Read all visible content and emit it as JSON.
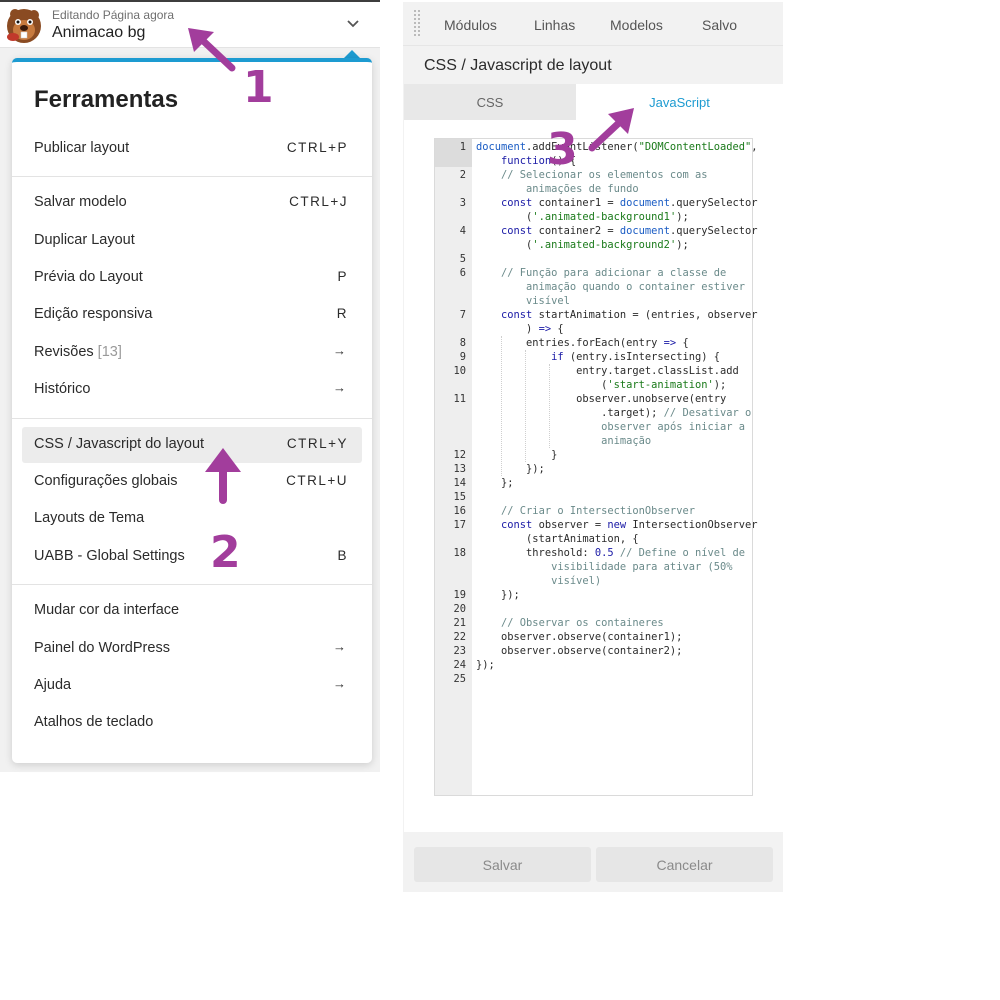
{
  "header": {
    "editing_label": "Editando Página agora",
    "page_name": "Animacao bg"
  },
  "menu": {
    "title": "Ferramentas",
    "items": [
      {
        "label": "Publicar layout",
        "shortcut": "CTRL+P"
      },
      {
        "label": "Salvar modelo",
        "shortcut": "CTRL+J"
      },
      {
        "label": "Duplicar Layout",
        "shortcut": ""
      },
      {
        "label": "Prévia do Layout",
        "shortcut": "P"
      },
      {
        "label": "Edição responsiva",
        "shortcut": "R"
      },
      {
        "label": "Revisões",
        "count": "[13]",
        "arrow": "→"
      },
      {
        "label": "Histórico",
        "arrow": "→"
      },
      {
        "label": "CSS / Javascript do layout",
        "shortcut": "CTRL+Y"
      },
      {
        "label": "Configurações globais",
        "shortcut": "CTRL+U"
      },
      {
        "label": "Layouts de Tema",
        "shortcut": ""
      },
      {
        "label": "UABB - Global Settings",
        "shortcut": "B"
      },
      {
        "label": "Mudar cor da interface",
        "shortcut": ""
      },
      {
        "label": "Painel do WordPress",
        "arrow": "→"
      },
      {
        "label": "Ajuda",
        "arrow": "→"
      },
      {
        "label": "Atalhos de teclado",
        "shortcut": ""
      }
    ]
  },
  "annotations": {
    "one": "1",
    "two": "2",
    "three": "3"
  },
  "right_panel": {
    "tabs": [
      "Módulos",
      "Linhas",
      "Modelos",
      "Salvo"
    ],
    "title": "CSS / Javascript de layout",
    "code_tabs": [
      "CSS",
      "JavaScript"
    ],
    "active_code_tab": "JavaScript",
    "save_label": "Salvar",
    "cancel_label": "Cancelar"
  },
  "code": {
    "line_numbers": [
      "1",
      "2",
      "3",
      "4",
      "5",
      "6",
      "7",
      "8",
      "9",
      "10",
      "11",
      "12",
      "13",
      "14",
      "15",
      "16",
      "17",
      "18",
      "19",
      "20",
      "21",
      "22",
      "23",
      "24",
      "25"
    ]
  },
  "colors": {
    "accent": "#1d9bd1",
    "annotation": "#a23d9c",
    "js_tab_text": "#1d9bd1"
  }
}
